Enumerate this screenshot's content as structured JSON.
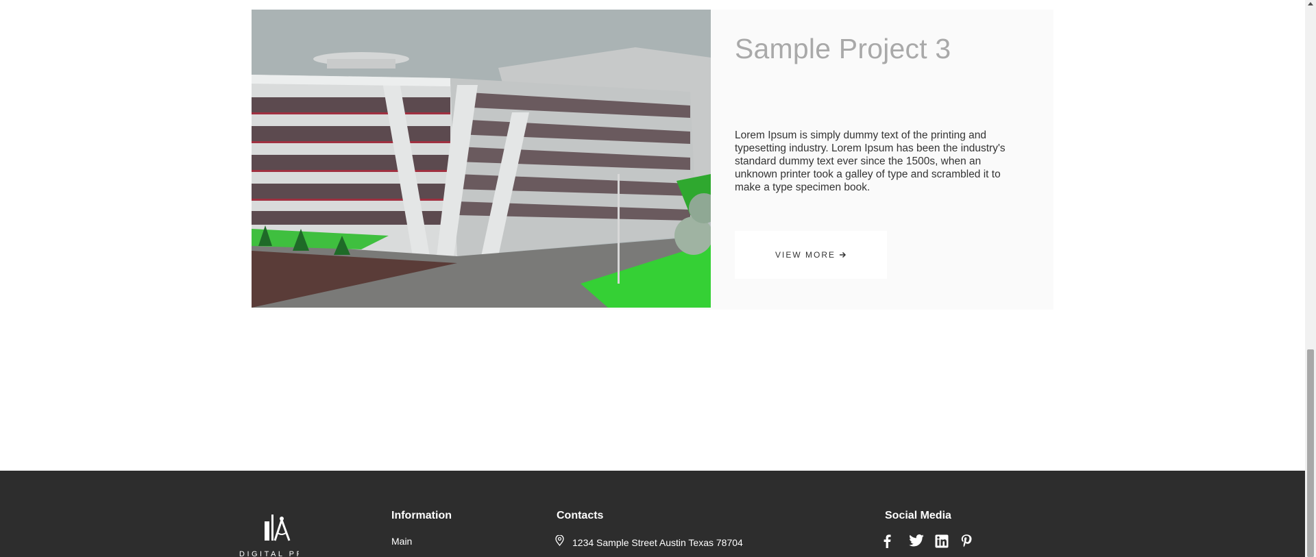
{
  "project": {
    "title": "Sample Project 3",
    "description": "Lorem Ipsum is simply dummy text of the printing and typesetting industry. Lorem Ipsum has been the industry's standard dummy text ever since the 1500s, when an unknown printer took a galley of type and scrambled it to make a type specimen book.",
    "button_label": "VIEW MORE",
    "button_icon": "arrow-right-icon",
    "image": "architecture-building-render"
  },
  "footer": {
    "logo_text": "DIGITAL PROJECT",
    "information": {
      "title": "Information",
      "links": [
        "Main"
      ]
    },
    "contacts": {
      "title": "Contacts",
      "address_icon": "map-pin-icon",
      "address": "1234 Sample Street Austin Texas 78704"
    },
    "social": {
      "title": "Social Media",
      "icons": [
        "facebook-icon",
        "twitter-icon",
        "linkedin-icon",
        "pinterest-icon"
      ]
    }
  },
  "colors": {
    "footer_bg": "#2d2d2d",
    "card_bg": "#fafafa",
    "title": "#a9a9a9",
    "text": "#333333"
  }
}
